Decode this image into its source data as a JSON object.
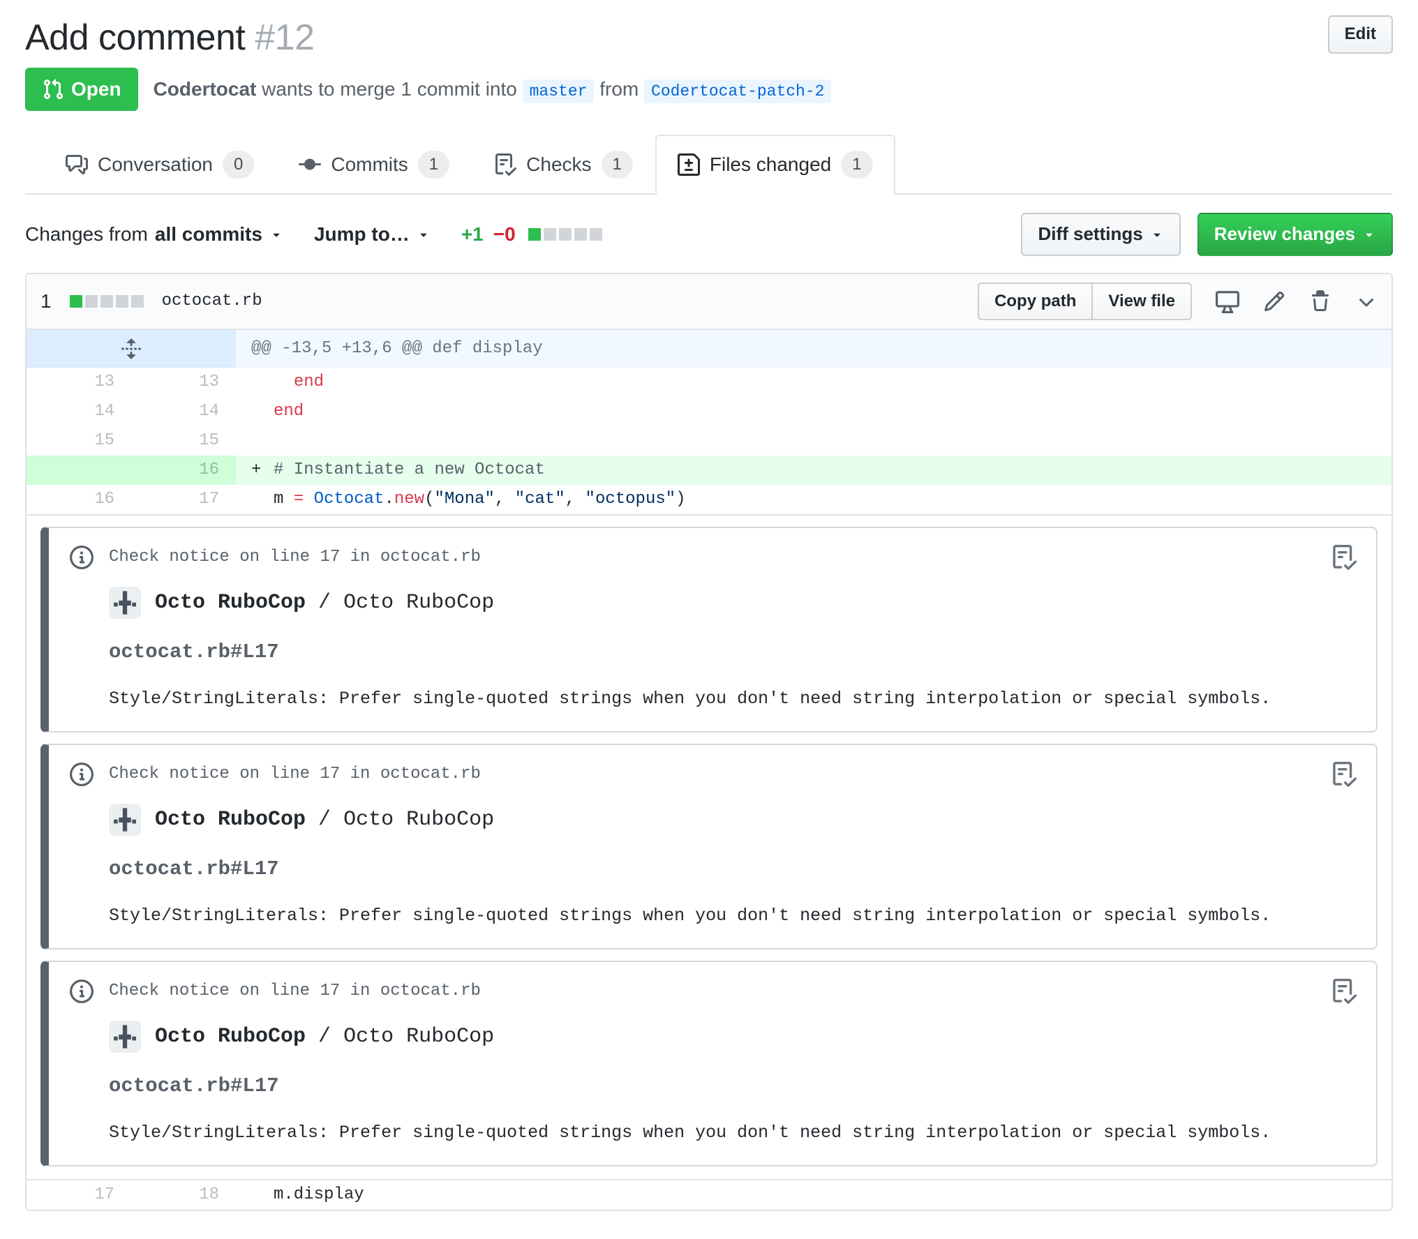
{
  "colors": {
    "open_badge_green": "#2cbe4e",
    "primary_button_green": "#28a745",
    "addition_green_text": "#28a745",
    "deletion_red_text": "#cb2431",
    "branch_label_blue": "#0366d6",
    "branch_label_bg": "#eaf5ff",
    "added_line_bg": "#e6ffed",
    "added_gutter_bg": "#cdffd8",
    "hunk_gutter_bg": "#dbedff",
    "hunk_code_bg": "#f1f8ff",
    "keyword_red": "#d73a49",
    "constant_blue": "#005cc5",
    "string_blue": "#032f62",
    "notice_border_bar": "#59636e"
  },
  "icons": {
    "conversation_tab": "comment-discussion-icon",
    "commits_tab": "git-commit-icon",
    "checks_tab": "tasklist-icon",
    "files_changed_tab": "file-diff-icon",
    "state_badge": "git-pull-request-icon",
    "hunk_gutter": "unfold-icon",
    "file_actions": [
      "display-rich-diff-icon",
      "pencil-icon",
      "trash-icon",
      "chevron-down-icon"
    ],
    "notice_left": "info-icon",
    "notice_corner": "tasklist-icon",
    "dropdowns": "caret-down-icon"
  },
  "header": {
    "title": "Add comment",
    "number": "#12",
    "edit_label": "Edit"
  },
  "meta": {
    "state_label": "Open",
    "author": "Codertocat",
    "action_text": "wants to merge 1 commit into",
    "base_branch": "master",
    "from_text": "from",
    "head_branch": "Codertocat-patch-2"
  },
  "tabs": [
    {
      "label": "Conversation",
      "count": "0",
      "active": false
    },
    {
      "label": "Commits",
      "count": "1",
      "active": false
    },
    {
      "label": "Checks",
      "count": "1",
      "active": false
    },
    {
      "label": "Files changed",
      "count": "1",
      "active": true
    }
  ],
  "toolbar": {
    "changes_from": "Changes from",
    "changes_from_value": "all commits",
    "jump_to": "Jump to…",
    "additions": "+1",
    "deletions": "−0",
    "diff_settings_label": "Diff settings",
    "review_changes_label": "Review changes"
  },
  "file": {
    "stat_count": "1",
    "name": "octocat.rb",
    "copy_path_label": "Copy path",
    "view_file_label": "View file"
  },
  "diff": {
    "hunk_header": "@@ -13,5 +13,6 @@ def display",
    "rows": [
      {
        "old": "13",
        "new": "13",
        "indent": "  ",
        "keyword": "end"
      },
      {
        "old": "14",
        "new": "14",
        "keyword": "end"
      },
      {
        "old": "15",
        "new": "15"
      },
      {
        "old": "",
        "new": "16",
        "marker": "+",
        "comment": "# Instantiate a new Octocat"
      },
      {
        "old": "16",
        "new": "17",
        "tokens": {
          "var": "m ",
          "eq": "=",
          "sp": " ",
          "const": "Octocat",
          "dot": ".",
          "method": "new",
          "open": "(",
          "str1": "\"Mona\"",
          "comma1": ", ",
          "str2": "\"cat\"",
          "comma2": ", ",
          "str3": "\"octopus\"",
          "close": ")"
        }
      },
      {
        "old": "17",
        "new": "18",
        "plain": "m.display"
      }
    ]
  },
  "notices": [
    {
      "header": "Check notice on line 17 in octocat.rb",
      "app_name": "Octo RuboCop",
      "separator": " / ",
      "app_context": "Octo RuboCop",
      "location": "octocat.rb#L17",
      "message": "Style/StringLiterals: Prefer single-quoted strings when you don't need string interpolation or special symbols."
    },
    {
      "header": "Check notice on line 17 in octocat.rb",
      "app_name": "Octo RuboCop",
      "separator": " / ",
      "app_context": "Octo RuboCop",
      "location": "octocat.rb#L17",
      "message": "Style/StringLiterals: Prefer single-quoted strings when you don't need string interpolation or special symbols."
    },
    {
      "header": "Check notice on line 17 in octocat.rb",
      "app_name": "Octo RuboCop",
      "separator": " / ",
      "app_context": "Octo RuboCop",
      "location": "octocat.rb#L17",
      "message": "Style/StringLiterals: Prefer single-quoted strings when you don't need string interpolation or special symbols."
    }
  ]
}
